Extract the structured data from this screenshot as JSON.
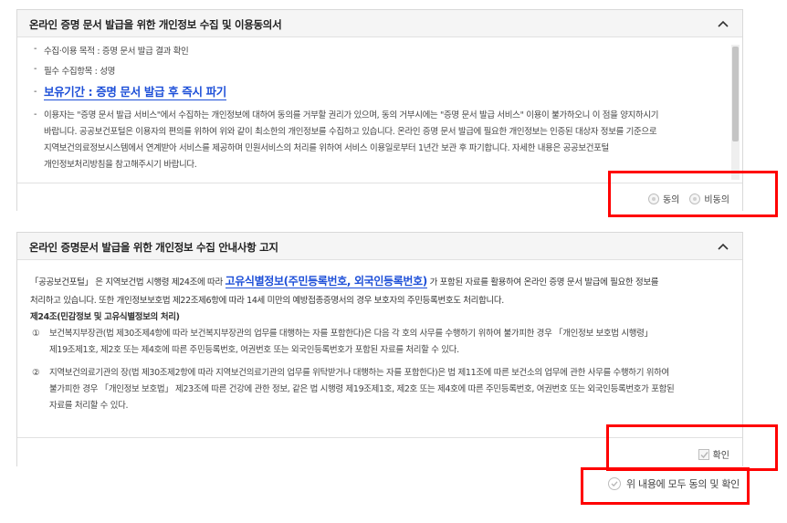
{
  "panel1": {
    "title": "온라인 증명 문서 발급을 위한 개인정보 수집 및 이용동의서",
    "purpose": "수집·이용 목적 : 증명 문서 발급 결과 확인",
    "required_items": "필수 수집항목 : 성명",
    "retention": "보유기간 : 증명 문서 발급 후 즉시 파기",
    "notice_lines": [
      "이용자는 \"증명 문서 발급 서비스\"에서 수집하는 개인정보에 대하여 동의를 거부할 권리가 있으며, 동의 거부시에는 \"증명 문서 발급 서비스\" 이용이 불가하오니 이 점을 양지하시기",
      "바랍니다. 공공보건포털은 이용자의 편의를 위하여 위와 같이 최소한의 개인정보를 수집하고 있습니다. 온라인 증명 문서 발급에 필요한 개인정보는 인증된 대상자 정보를 기준으로",
      "지역보건의료정보시스템에서 연계받아 서비스를 제공하며 민원서비스의 처리를 위하여 서비스 이용일로부터 1년간 보관 후 파기합니다. 자세한 내용은 공공보건포털",
      "개인정보처리방침을 참고해주시기 바랍니다."
    ],
    "agree_label": "동의",
    "disagree_label": "비동의"
  },
  "panel2": {
    "title": "온라인 증명문서 발급을 위한 개인정보 수집 안내사항 고지",
    "intro_before": "「공공보건포털」 은 지역보건법 시행령 제24조에 따라 ",
    "intro_highlight": "고유식별정보(주민등록번호, 외국인등록번호)",
    "intro_after": " 가 포함된 자료를 활용하여 온라인 증명 문서 발급에 필요한 정보를",
    "line2": "처리하고 있습니다. 또한 개인정보보호법 제22조제6항에 따라 14세 미만의 예방접종증명서의 경우 보호자의 주민등록번호도 처리합니다.",
    "article": "제24조(민감정보 및 고유식별정보의 처리)",
    "items": [
      {
        "num": "①",
        "lines": [
          "보건복지부장관(법 제30조제4항에 따라 보건복지부장관의 업무를 대행하는 자를 포함한다)은 다음 각 호의 사무를 수행하기 위하여 불가피한 경우 「개인정보 보호법 시행령」",
          "제19조제1호, 제2호 또는 제4호에 따른 주민등록번호, 여권번호 또는 외국인등록번호가 포함된 자료를 처리할 수 있다."
        ]
      },
      {
        "num": "②",
        "lines": [
          "지역보건의료기관의 장(법 제30조제2항에 따라 지역보건의료기관의 업무를 위탁받거나 대행하는 자를 포함한다)은 법 제11조에 따른 보건소의 업무에 관한 사무를 수행하기 위하여",
          "불가피한 경우 「개인정보 보호법」 제23조에 따른 건강에 관한 정보, 같은 법 시행령 제19조제1호, 제2호 또는 제4호에 따른 주민등록번호, 여권번호 또는 외국인등록번호가 포함된",
          "자료를 처리할 수 있다."
        ]
      }
    ],
    "confirm_label": "확인"
  },
  "all_agree_label": "위 내용에 모두 동의 및 확인",
  "colors": {
    "accent_blue": "#1d4fd8",
    "annotation_red": "#ff0000",
    "header_bg": "#f5f5f5"
  },
  "icons": [
    "chevron-up-icon",
    "radio-icon",
    "check-icon",
    "circle-check-icon"
  ]
}
